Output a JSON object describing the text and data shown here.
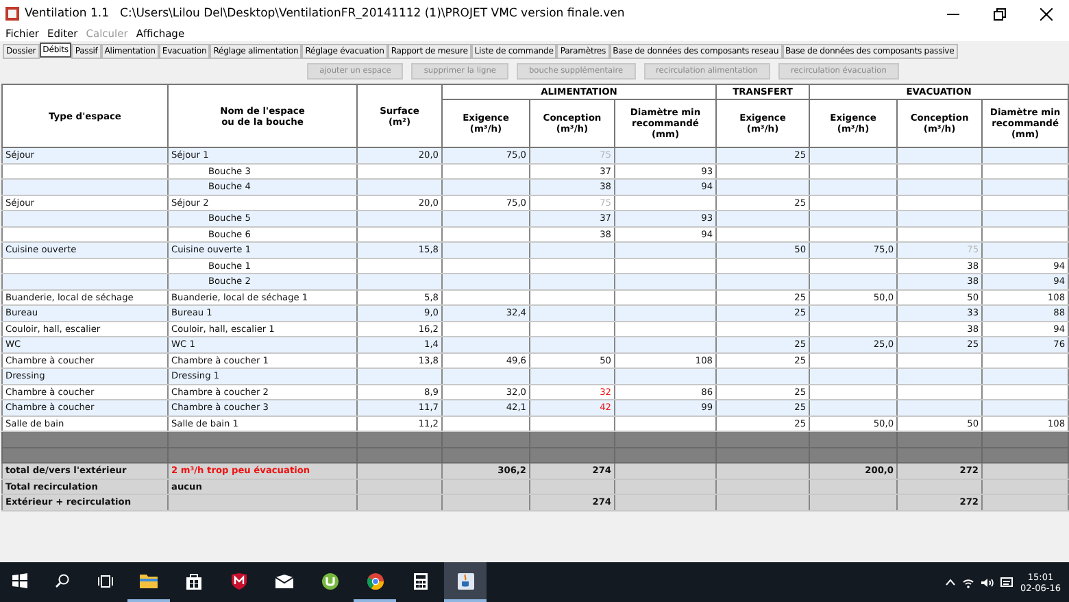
{
  "window": {
    "app": "Ventilation 1.1",
    "path": "C:\\Users\\Lilou Del\\Desktop\\VentilationFR_20141112 (1)\\PROJET VMC version finale.ven"
  },
  "menu": [
    {
      "label": "Fichier",
      "disabled": false
    },
    {
      "label": "Editer",
      "disabled": false
    },
    {
      "label": "Calculer",
      "disabled": true
    },
    {
      "label": "Affichage",
      "disabled": false
    }
  ],
  "tabs": [
    {
      "label": "Dossier",
      "selected": false
    },
    {
      "label": "Débits",
      "selected": true
    },
    {
      "label": "Passif",
      "selected": false
    },
    {
      "label": "Alimentation",
      "selected": false
    },
    {
      "label": "Evacuation",
      "selected": false
    },
    {
      "label": "Réglage alimentation",
      "selected": false
    },
    {
      "label": "Réglage évacuation",
      "selected": false
    },
    {
      "label": "Rapport de mesure",
      "selected": false
    },
    {
      "label": "Liste de commande",
      "selected": false
    },
    {
      "label": "Paramètres",
      "selected": false
    },
    {
      "label": "Base de données des composants reseau",
      "selected": false
    },
    {
      "label": "Base de données des composants passive",
      "selected": false
    }
  ],
  "toolbar_buttons": [
    {
      "label": "ajouter un espace",
      "disabled": true
    },
    {
      "label": "supprimer la ligne",
      "disabled": true
    },
    {
      "label": "bouche supplémentaire",
      "disabled": true
    },
    {
      "label": "recirculation alimentation",
      "disabled": true
    },
    {
      "label": "recirculation évacuation",
      "disabled": true
    }
  ],
  "table": {
    "fixed_columns": [
      "Type d'espace",
      "Nom de l'espace\nou de la bouche",
      "Surface\n(m²)"
    ],
    "groups": [
      {
        "title": "ALIMENTATION",
        "columns": [
          "Exigence\n(m³/h)",
          "Conception\n(m³/h)",
          "Diamètre min\nrecommandé\n(mm)"
        ]
      },
      {
        "title": "TRANSFERT",
        "columns": [
          "Exigence\n(m³/h)"
        ]
      },
      {
        "title": "EVACUATION",
        "columns": [
          "Exigence\n(m³/h)",
          "Conception\n(m³/h)",
          "Diamètre min\nrecommandé\n(mm)"
        ]
      }
    ],
    "rows": [
      {
        "kind": "space",
        "cells": [
          "Séjour",
          "Séjour 1",
          "20,0",
          "75,0",
          {
            "text": "75",
            "dimmed": true
          },
          null,
          "25",
          null,
          null,
          null
        ]
      },
      {
        "kind": "outlet",
        "cells": [
          null,
          "Bouche 3",
          null,
          null,
          "37",
          "93",
          null,
          null,
          null,
          null
        ]
      },
      {
        "kind": "outlet",
        "cells": [
          null,
          "Bouche 4",
          null,
          null,
          "38",
          "94",
          null,
          null,
          null,
          null
        ]
      },
      {
        "kind": "space",
        "cells": [
          "Séjour",
          "Séjour 2",
          "20,0",
          "75,0",
          {
            "text": "75",
            "dimmed": true
          },
          null,
          "25",
          null,
          null,
          null
        ]
      },
      {
        "kind": "outlet",
        "cells": [
          null,
          "Bouche 5",
          null,
          null,
          "37",
          "93",
          null,
          null,
          null,
          null
        ]
      },
      {
        "kind": "outlet",
        "cells": [
          null,
          "Bouche 6",
          null,
          null,
          "38",
          "94",
          null,
          null,
          null,
          null
        ]
      },
      {
        "kind": "space",
        "cells": [
          "Cuisine ouverte",
          "Cuisine ouverte 1",
          "15,8",
          null,
          null,
          null,
          "50",
          "75,0",
          {
            "text": "75",
            "dimmed": true
          },
          null
        ]
      },
      {
        "kind": "outlet",
        "cells": [
          null,
          "Bouche 1",
          null,
          null,
          null,
          null,
          null,
          null,
          "38",
          "94"
        ]
      },
      {
        "kind": "outlet",
        "cells": [
          null,
          "Bouche 2",
          null,
          null,
          null,
          null,
          null,
          null,
          "38",
          "94"
        ]
      },
      {
        "kind": "space",
        "cells": [
          "Buanderie, local de séchage",
          "Buanderie, local de séchage 1",
          "5,8",
          null,
          null,
          null,
          "25",
          "50,0",
          "50",
          "108"
        ]
      },
      {
        "kind": "space",
        "cells": [
          "Bureau",
          "Bureau 1",
          "9,0",
          "32,4",
          null,
          null,
          "25",
          null,
          "33",
          "88"
        ]
      },
      {
        "kind": "space",
        "cells": [
          "Couloir, hall, escalier",
          "Couloir, hall, escalier 1",
          "16,2",
          null,
          null,
          null,
          null,
          null,
          "38",
          "94"
        ]
      },
      {
        "kind": "space",
        "cells": [
          "WC",
          "WC 1",
          "1,4",
          null,
          null,
          null,
          "25",
          "25,0",
          "25",
          "76"
        ]
      },
      {
        "kind": "space",
        "cells": [
          "Chambre à coucher",
          "Chambre à coucher 1",
          "13,8",
          "49,6",
          "50",
          "108",
          "25",
          null,
          null,
          null
        ]
      },
      {
        "kind": "space",
        "cells": [
          "Dressing",
          "Dressing 1",
          null,
          null,
          null,
          null,
          null,
          null,
          null,
          null
        ]
      },
      {
        "kind": "space",
        "cells": [
          "Chambre à coucher",
          "Chambre à coucher 2",
          "8,9",
          "32,0",
          {
            "text": "32",
            "warning": true
          },
          "86",
          "25",
          null,
          null,
          null
        ]
      },
      {
        "kind": "space",
        "cells": [
          "Chambre à coucher",
          "Chambre à coucher 3",
          "11,7",
          "42,1",
          {
            "text": "42",
            "warning": true
          },
          "99",
          "25",
          null,
          null,
          null
        ]
      },
      {
        "kind": "space",
        "cells": [
          "Salle de bain",
          "Salle de bain 1",
          "11,2",
          null,
          null,
          null,
          "25",
          "50,0",
          "50",
          "108"
        ]
      },
      {
        "kind": "separator",
        "cells": []
      },
      {
        "kind": "separator",
        "cells": []
      },
      {
        "kind": "total",
        "cells": [
          "total de/vers l'extérieur",
          {
            "text": "2 m³/h trop peu évacuation",
            "warning": true
          },
          null,
          "306,2",
          "274",
          null,
          null,
          "200,0",
          "272",
          null
        ]
      },
      {
        "kind": "total",
        "cells": [
          "Total recirculation",
          "aucun",
          null,
          null,
          null,
          null,
          null,
          null,
          null,
          null
        ]
      },
      {
        "kind": "total",
        "cells": [
          "Extérieur + recirculation",
          null,
          null,
          null,
          "274",
          null,
          null,
          null,
          "272",
          null
        ]
      }
    ]
  },
  "taskbar": {
    "apps": [
      {
        "kind": "start",
        "open": false,
        "selected": false
      },
      {
        "kind": "search",
        "open": false,
        "selected": false
      },
      {
        "kind": "task-view",
        "open": false,
        "selected": false
      },
      {
        "kind": "folder",
        "open": true,
        "selected": false
      },
      {
        "kind": "store",
        "open": false,
        "selected": false
      },
      {
        "kind": "shield",
        "open": false,
        "selected": false
      },
      {
        "kind": "mail",
        "open": false,
        "selected": false
      },
      {
        "kind": "torrent",
        "open": false,
        "selected": false
      },
      {
        "kind": "browser",
        "open": true,
        "selected": false
      },
      {
        "kind": "calculator",
        "open": false,
        "selected": false
      },
      {
        "kind": "java",
        "open": true,
        "selected": true
      }
    ],
    "time": "15:01",
    "date": "02-06-16"
  }
}
